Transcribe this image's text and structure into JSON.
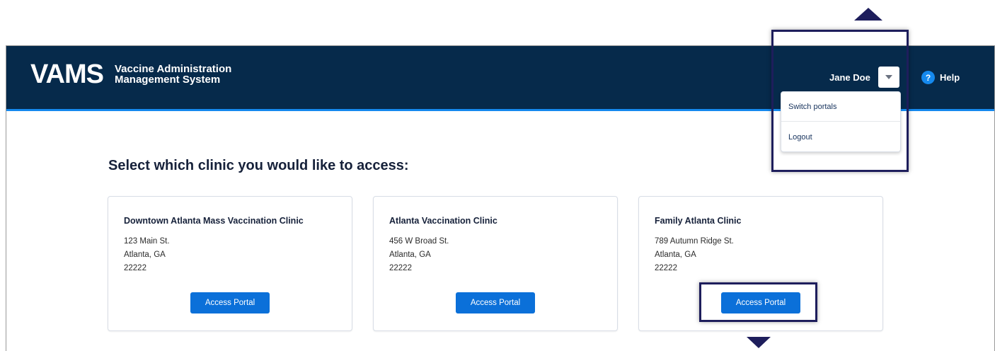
{
  "header": {
    "logo_text": "VAMS",
    "app_name_line1": "Vaccine Administration",
    "app_name_line2": "Management System",
    "user_name": "Jane Doe",
    "help_label": "Help",
    "user_menu_icon": "chevron-down-icon",
    "help_icon": "question-circle-icon"
  },
  "user_menu": {
    "items": [
      {
        "label": "Switch portals"
      },
      {
        "label": "Logout"
      }
    ]
  },
  "main": {
    "heading": "Select which clinic you would like to access:",
    "clinics": [
      {
        "name": "Downtown Atlanta Mass Vaccination Clinic",
        "street": "123 Main St.",
        "city": "Atlanta, GA",
        "zip": "22222",
        "button_label": "Access Portal"
      },
      {
        "name": "Atlanta Vaccination Clinic",
        "street": "456 W Broad St.",
        "city": "Atlanta, GA",
        "zip": "22222",
        "button_label": "Access Portal"
      },
      {
        "name": "Family Atlanta Clinic",
        "street": "789 Autumn Ridge St.",
        "city": "Atlanta, GA",
        "zip": "22222",
        "button_label": "Access Portal"
      }
    ]
  },
  "colors": {
    "header_bg": "#062a4b",
    "accent_blue": "#1589ee",
    "button_blue": "#0b70d9",
    "annotation_navy": "#1e1e5c"
  }
}
